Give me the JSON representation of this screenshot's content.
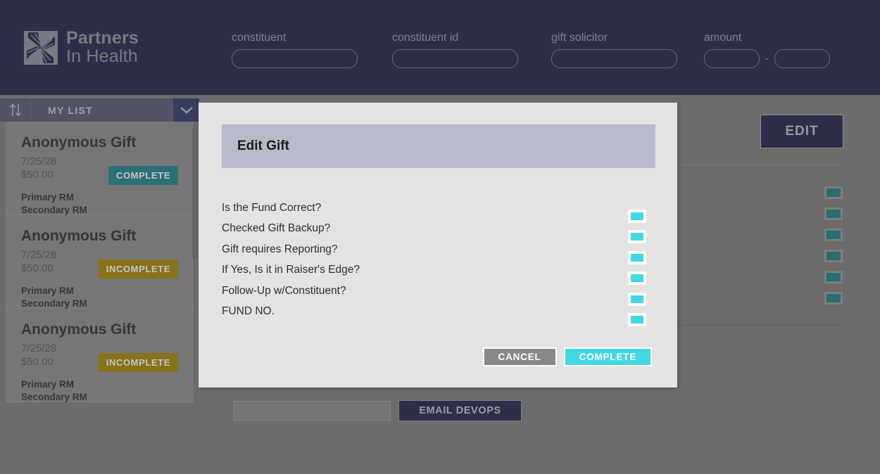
{
  "brand": {
    "name_line1": "Partners",
    "name_line2": "In Health",
    "logo_icon": "pinwheel-logo-icon",
    "accent_navy": "#1e1f45",
    "accent_cyan": "#41d8e3",
    "accent_teal": "#1b8089",
    "accent_gold": "#a38200"
  },
  "search": {
    "fields": [
      {
        "label": "constituent",
        "value": "",
        "placeholder": ""
      },
      {
        "label": "constituent id",
        "value": "",
        "placeholder": ""
      },
      {
        "label": "gift solicitor",
        "value": "",
        "placeholder": ""
      }
    ],
    "amount": {
      "label": "amount",
      "min_value": "",
      "max_value": "",
      "separator": "-"
    }
  },
  "sidebar": {
    "sort_icon": "sort-up-down-icon",
    "list_name": "MY LIST",
    "dropdown_icon": "chevron-down-icon",
    "cards": [
      {
        "title": "Anonymous Gift",
        "date": "7/25/28",
        "amount": "$50.00",
        "status": "COMPLETE",
        "status_type": "complete",
        "primary_rm": "Primary RM",
        "secondary_rm": "Secondary RM"
      },
      {
        "title": "Anonymous Gift",
        "date": "7/25/28",
        "amount": "$50.00",
        "status": "INCOMPLETE",
        "status_type": "incomplete",
        "primary_rm": "Primary RM",
        "secondary_rm": "Secondary RM"
      },
      {
        "title": "Anonymous Gift",
        "date": "7/25/28",
        "amount": "$50.00",
        "status": "INCOMPLETE",
        "status_type": "incomplete",
        "primary_rm": "Primary RM",
        "secondary_rm": "Secondary RM"
      }
    ]
  },
  "content": {
    "edit_label": "EDIT",
    "background_checkbox_count": 6,
    "devops": {
      "input_value": "",
      "button_label": "EMAIL DEVOPS"
    }
  },
  "modal": {
    "title": "Edit Gift",
    "questions": [
      {
        "label": "Is the Fund Correct?",
        "checked": true
      },
      {
        "label": "Checked Gift Backup?",
        "checked": true
      },
      {
        "label": "Gift requires Reporting?",
        "checked": true
      },
      {
        "label": "If Yes, Is it in Raiser's Edge?",
        "checked": true
      },
      {
        "label": "Follow-Up w/Constituent?",
        "checked": true
      },
      {
        "label": "FUND NO.",
        "checked": true
      }
    ],
    "cancel_label": "CANCEL",
    "complete_label": "COMPLETE"
  }
}
